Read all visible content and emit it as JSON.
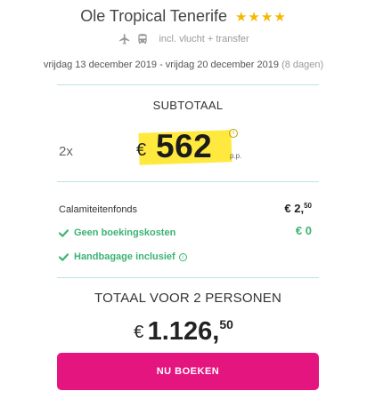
{
  "hotel": {
    "name": "Ole Tropical Tenerife",
    "stars": "★★★★"
  },
  "transport": {
    "icons": [
      "plane-icon",
      "bus-icon"
    ],
    "text": "incl. vlucht + transfer"
  },
  "dates": {
    "range": "vrijdag 13 december 2019 - vrijdag 20 december 2019",
    "nights": "(8 dagen)"
  },
  "subtotal": {
    "label": "SUBTOTAAL",
    "pax": "2x",
    "currency": "€",
    "amount": "562",
    "per_person": "p.p.",
    "info": "i"
  },
  "fees": {
    "calamity_label": "Calamiteitenfonds",
    "calamity_currency": "€",
    "calamity_whole": "2,",
    "calamity_cents": "50"
  },
  "benefits": [
    {
      "label": "Geen boekingskosten",
      "value": "€ 0"
    },
    {
      "label": "Handbagage inclusief",
      "info": "i"
    }
  ],
  "total": {
    "label": "TOTAAL VOOR 2 PERSONEN",
    "currency": "€",
    "amount": "1.126,",
    "cents": "50"
  },
  "cta": {
    "label": "NU BOEKEN"
  },
  "colors": {
    "accent": "#e5157f",
    "highlight": "#ffe93f",
    "positive": "#3cb371",
    "stars": "#f5b800",
    "divider": "#bfe0e8"
  }
}
